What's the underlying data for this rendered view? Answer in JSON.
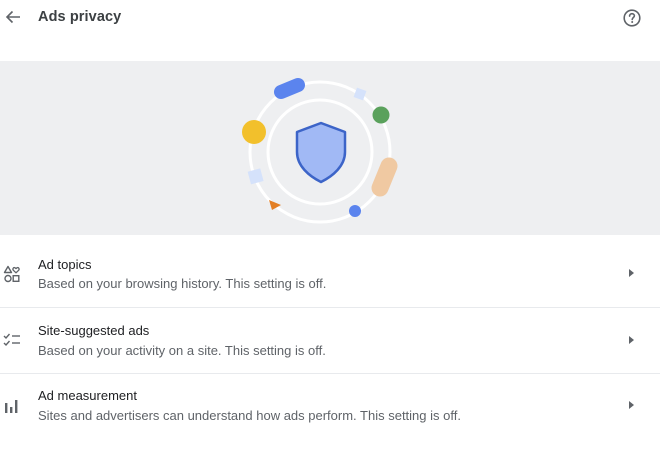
{
  "header": {
    "title": "Ads privacy",
    "back_icon": "arrow-back-icon",
    "help_icon": "help-circle-icon"
  },
  "hero": {
    "illustration": "shield-privacy-illustration",
    "colors": {
      "background": "#eeeff1",
      "shield_fill": "#a1b9f5",
      "shield_stroke": "#3c64c8",
      "blue": "#5b84ee",
      "green": "#5aa15c",
      "yellow": "#f2c02c",
      "peach": "#f0c9a2",
      "orange": "#e37f25",
      "light_blue": "#d5e2fb"
    }
  },
  "list": {
    "items": [
      {
        "title": "Ad topics",
        "subtitle": "Based on your browsing history. This setting is off.",
        "icon": "shapes-icon"
      },
      {
        "title": "Site-suggested ads",
        "subtitle": "Based on your activity on a site. This setting is off.",
        "icon": "checklist-icon"
      },
      {
        "title": "Ad measurement",
        "subtitle": "Sites and advertisers can understand how ads perform. This setting is off.",
        "icon": "bar-chart-icon"
      }
    ]
  }
}
